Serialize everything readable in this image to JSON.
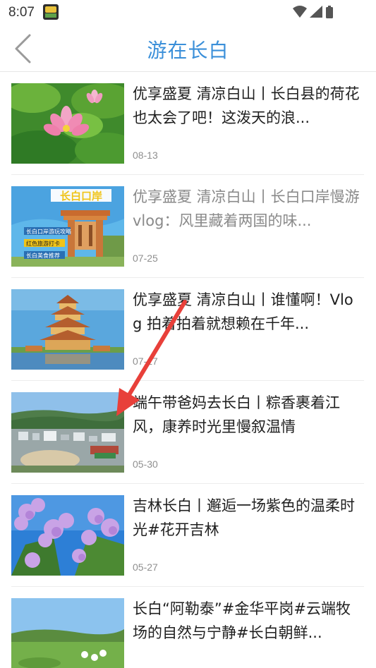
{
  "status_bar": {
    "time": "8:07",
    "app_icon": "game-app-icon",
    "icons": [
      "wifi-icon",
      "signal-icon",
      "battery-icon"
    ]
  },
  "header": {
    "title": "游在长白",
    "back_icon": "chevron-left-icon",
    "accent_color": "#3a8fd9"
  },
  "articles": [
    {
      "title": "优享盛夏 清凉白山丨长白县的荷花也太会了吧！这泼天的浪...",
      "date": "08-13",
      "visited": false,
      "thumb": "lotus-flower-photo"
    },
    {
      "title": "优享盛夏 清凉白山丨长白口岸慢游 vlog：风里藏着两国的味...",
      "date": "07-25",
      "visited": true,
      "thumb": "border-gate-photo",
      "thumb_text": {
        "headline": "长白口岸",
        "tag1": "长白口岸游玩攻略",
        "tag2": "红色旅游打卡",
        "tag3": "长白美食推荐"
      }
    },
    {
      "title": "优享盛夏 清凉白山丨谁懂啊！Vlog 拍着拍着就想赖在千年...",
      "date": "07-17",
      "visited": false,
      "thumb": "pagoda-photo"
    },
    {
      "title": "端午带爸妈去长白丨粽香裹着江风，康养时光里慢叙温情",
      "date": "05-30",
      "visited": false,
      "thumb": "city-aerial-photo"
    },
    {
      "title": "吉林长白丨邂逅一场紫色的温柔时光#花开吉林",
      "date": "05-27",
      "visited": false,
      "thumb": "lilac-flower-photo"
    },
    {
      "title": "长白“阿勒泰”#金华平岗#云端牧场的自然与宁静#长白朝鲜...",
      "date": "",
      "visited": false,
      "thumb": "meadow-photo"
    }
  ],
  "annotation": {
    "type": "red-arrow",
    "color": "#e8403a"
  }
}
